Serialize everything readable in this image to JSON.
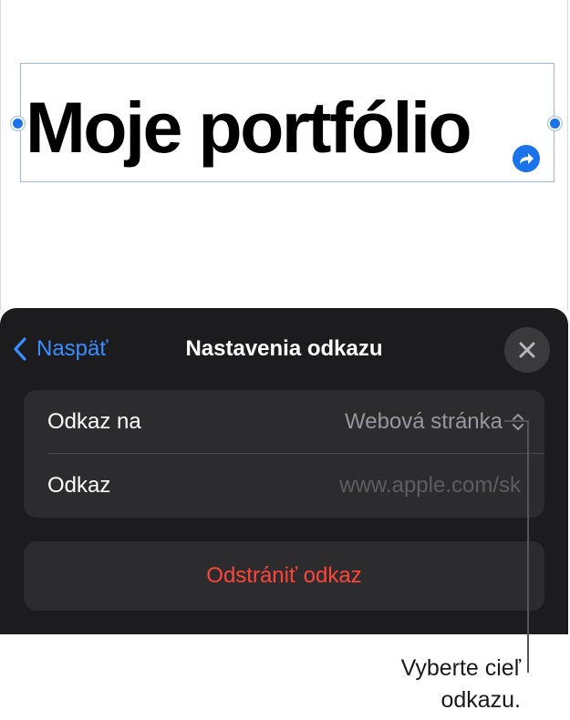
{
  "document": {
    "title_text": "Moje portfólio"
  },
  "link_settings": {
    "back_label": "Naspäť",
    "title": "Nastavenia odkazu",
    "link_to_label": "Odkaz na",
    "link_to_value": "Webová stránka",
    "link_label": "Odkaz",
    "link_placeholder": "www.apple.com/sk",
    "remove_label": "Odstrániť odkaz"
  },
  "callout": {
    "line1": "Vyberte cieľ",
    "line2": "odkazu."
  },
  "colors": {
    "accent": "#3a8dff",
    "destructive": "#ff453a",
    "panel_bg": "#1c1c1e",
    "group_bg": "#2c2c2e",
    "selection": "#1a73e8"
  },
  "icons": {
    "back": "chevron-left-icon",
    "close": "close-icon",
    "link_to_picker": "chevron-up-down-icon",
    "link_badge": "link-arrow-icon"
  }
}
